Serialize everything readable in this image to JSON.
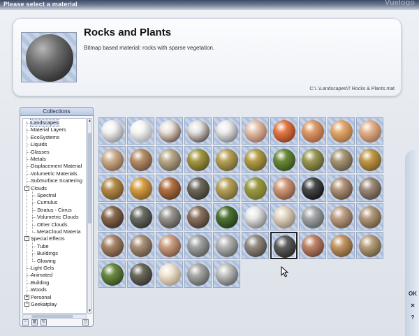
{
  "window": {
    "title": "Please select a material",
    "watermark": "Vuelogo"
  },
  "header": {
    "material_name": "Rocks and Plants",
    "description": "Bitmap based material: rocks with sparse vegetation.",
    "path": "C:\\..\\Landscapes\\T Rocks & Plants.mat"
  },
  "collections": {
    "title": "Collections",
    "items": [
      {
        "label": "Landscapes",
        "level": 0,
        "expander": "",
        "selected": true
      },
      {
        "label": "Material Layers",
        "level": 0,
        "expander": ""
      },
      {
        "label": "EcoSystems",
        "level": 0,
        "expander": ""
      },
      {
        "label": "Liquids",
        "level": 0,
        "expander": ""
      },
      {
        "label": "Glasses",
        "level": 0,
        "expander": ""
      },
      {
        "label": "Metals",
        "level": 0,
        "expander": ""
      },
      {
        "label": "Displacement Material",
        "level": 0,
        "expander": ""
      },
      {
        "label": "Volumetric Materials",
        "level": 0,
        "expander": ""
      },
      {
        "label": "SubSurface Scattering",
        "level": 0,
        "expander": ""
      },
      {
        "label": "Clouds",
        "level": 0,
        "expander": "-"
      },
      {
        "label": "Spectral",
        "level": 1,
        "expander": ""
      },
      {
        "label": "Cumulus",
        "level": 1,
        "expander": ""
      },
      {
        "label": "Stratus - Cirrus",
        "level": 1,
        "expander": ""
      },
      {
        "label": "Volumetric Clouds",
        "level": 1,
        "expander": ""
      },
      {
        "label": "Other Clouds",
        "level": 1,
        "expander": ""
      },
      {
        "label": "MetaCloud Materia",
        "level": 1,
        "expander": ""
      },
      {
        "label": "Special Effects",
        "level": 0,
        "expander": "-"
      },
      {
        "label": "Tube",
        "level": 1,
        "expander": ""
      },
      {
        "label": "Buildings",
        "level": 1,
        "expander": ""
      },
      {
        "label": "Glowing",
        "level": 1,
        "expander": ""
      },
      {
        "label": "Light Gels",
        "level": 0,
        "expander": ""
      },
      {
        "label": "Animated",
        "level": 0,
        "expander": ""
      },
      {
        "label": "Building",
        "level": 0,
        "expander": ""
      },
      {
        "label": "Woods",
        "level": 0,
        "expander": ""
      },
      {
        "label": "Personal",
        "level": 0,
        "expander": "+"
      },
      {
        "label": "Geekatplay",
        "level": 0,
        "expander": "-"
      }
    ],
    "toolbar": [
      {
        "icon": "new-collection-icon",
        "glyph": "▫"
      },
      {
        "icon": "delete-icon",
        "glyph": "▥"
      },
      {
        "icon": "link-icon",
        "glyph": "↻"
      },
      {
        "icon": "lock-icon",
        "glyph": "▯"
      }
    ]
  },
  "materials": [
    {
      "icon": "sphere-white-smooth",
      "color": "#f3f3f3",
      "shade": "#8e8e8e"
    },
    {
      "icon": "sphere-snow",
      "color": "#f6f6f6",
      "shade": "#a5a5a5"
    },
    {
      "icon": "sphere-snow-rock",
      "color": "#e8e2dc",
      "shade": "#6a5141"
    },
    {
      "icon": "sphere-snow-rock-dark",
      "color": "#e3e3e3",
      "shade": "#5b4d44"
    },
    {
      "icon": "sphere-snow-patches",
      "color": "#ececec",
      "shade": "#7b7b7b"
    },
    {
      "icon": "sphere-striped-sand",
      "color": "#e4c3ad",
      "shade": "#9b6a50"
    },
    {
      "icon": "sphere-orange-rock",
      "color": "#e47b45",
      "shade": "#8a3a1c"
    },
    {
      "icon": "sphere-sandstone",
      "color": "#dd9c69",
      "shade": "#9b5a34"
    },
    {
      "icon": "sphere-tan-rock",
      "color": "#e2aa6f",
      "shade": "#9e6839"
    },
    {
      "icon": "sphere-pinkish-rock",
      "color": "#e3b48f",
      "shade": "#9a6a4b"
    },
    {
      "icon": "sphere-beige-rock",
      "color": "#cdb090",
      "shade": "#7e6040"
    },
    {
      "icon": "sphere-brown-rock",
      "color": "#b8906c",
      "shade": "#6a4c35"
    },
    {
      "icon": "sphere-grey-grass",
      "color": "#b9aa8c",
      "shade": "#6a5d47"
    },
    {
      "icon": "sphere-olive-grass",
      "color": "#a69b45",
      "shade": "#5a5220"
    },
    {
      "icon": "sphere-dry-grass",
      "color": "#b8a35a",
      "shade": "#695a2b"
    },
    {
      "icon": "sphere-yellow-grass",
      "color": "#b59f4b",
      "shade": "#685a23"
    },
    {
      "icon": "sphere-green-moss",
      "color": "#6d8a3b",
      "shade": "#364a1a"
    },
    {
      "icon": "sphere-mossy-rock",
      "color": "#9d9a56",
      "shade": "#55522a"
    },
    {
      "icon": "sphere-layered-rock",
      "color": "#a9987a",
      "shade": "#5f523d"
    },
    {
      "icon": "sphere-golden-sand",
      "color": "#c19a49",
      "shade": "#725723"
    },
    {
      "icon": "sphere-ochre-rock",
      "color": "#b68c4a",
      "shade": "#6c4e22"
    },
    {
      "icon": "sphere-orange-sand",
      "color": "#d7a046",
      "shade": "#83591f"
    },
    {
      "icon": "sphere-layered-red",
      "color": "#b37345",
      "shade": "#5e3820"
    },
    {
      "icon": "sphere-dark-rocky",
      "color": "#6f6a5e",
      "shade": "#36332c"
    },
    {
      "icon": "sphere-green-yellow",
      "color": "#b6a35b",
      "shade": "#6c5e2f"
    },
    {
      "icon": "sphere-grass-plane",
      "color": "#9b9a43",
      "shade": "#6e6b2a"
    },
    {
      "icon": "sphere-cracked-clay",
      "color": "#d19b7b",
      "shade": "#7d5039"
    },
    {
      "icon": "sphere-black-glossy",
      "color": "#4a4a4a",
      "shade": "#121212"
    },
    {
      "icon": "sphere-speckled-rock",
      "color": "#b2957a",
      "shade": "#5d4a3b"
    },
    {
      "icon": "sphere-grey-brown",
      "color": "#9e8b7b",
      "shade": "#53463c"
    },
    {
      "icon": "sphere-dark-dirt",
      "color": "#8a6b4d",
      "shade": "#3e2f22"
    },
    {
      "icon": "sphere-dark-stone",
      "color": "#6c6f66",
      "shade": "#2e302b"
    },
    {
      "icon": "sphere-rubble",
      "color": "#9b9793",
      "shade": "#4b4844"
    },
    {
      "icon": "sphere-brown-granite",
      "color": "#8c7360",
      "shade": "#433529"
    },
    {
      "icon": "sphere-green-bush",
      "color": "#4f7434",
      "shade": "#243816"
    },
    {
      "icon": "sphere-snowy-stone",
      "color": "#e8e8e8",
      "shade": "#7a7a7a"
    },
    {
      "icon": "sphere-pale-sand",
      "color": "#e3d6c2",
      "shade": "#8d7f6b"
    },
    {
      "icon": "sphere-grey-stone",
      "color": "#a5a8a9",
      "shade": "#5a5c5d"
    },
    {
      "icon": "sphere-tan-stone",
      "color": "#bfa086",
      "shade": "#6a5542"
    },
    {
      "icon": "sphere-mottled-tan",
      "color": "#b49a7b",
      "shade": "#634f3a"
    },
    {
      "icon": "sphere-sandy-dirt",
      "color": "#a8876a",
      "shade": "#5a4331"
    },
    {
      "icon": "sphere-pebbled-rock",
      "color": "#a99079",
      "shade": "#5c4a3a"
    },
    {
      "icon": "sphere-salmon-rock",
      "color": "#cc9f83",
      "shade": "#76513b"
    },
    {
      "icon": "sphere-slate",
      "color": "#a2a3a3",
      "shade": "#565757"
    },
    {
      "icon": "sphere-grey-smooth",
      "color": "#b5b5b5",
      "shade": "#606060"
    },
    {
      "icon": "sphere-gravel",
      "color": "#948b81",
      "shade": "#4a443e"
    },
    {
      "icon": "sphere-dark-granite",
      "color": "#5f5f5e",
      "shade": "#262626",
      "selected": true
    },
    {
      "icon": "sphere-orange-clay",
      "color": "#c0856a",
      "shade": "#6b4331"
    },
    {
      "icon": "sphere-amber-stone",
      "color": "#c39764",
      "shade": "#6f5131"
    },
    {
      "icon": "sphere-lichen-rock",
      "color": "#b7a07c",
      "shade": "#64543c"
    },
    {
      "icon": "sphere-moss-rock",
      "color": "#6c8a42",
      "shade": "#33461d"
    },
    {
      "icon": "sphere-dark-moss",
      "color": "#6d6a5d",
      "shade": "#34322b"
    },
    {
      "icon": "sphere-ivory",
      "color": "#f0e4d2",
      "shade": "#a6927a"
    },
    {
      "icon": "sphere-speckled-grey",
      "color": "#a8a8a6",
      "shade": "#5a5a59"
    },
    {
      "icon": "sphere-metal-grey",
      "color": "#c2c2c2",
      "shade": "#5e5e5e"
    }
  ],
  "side_buttons": {
    "ok": "OK",
    "cancel": "✕",
    "help": "?"
  },
  "selected_material_color": "#3a3a3a"
}
